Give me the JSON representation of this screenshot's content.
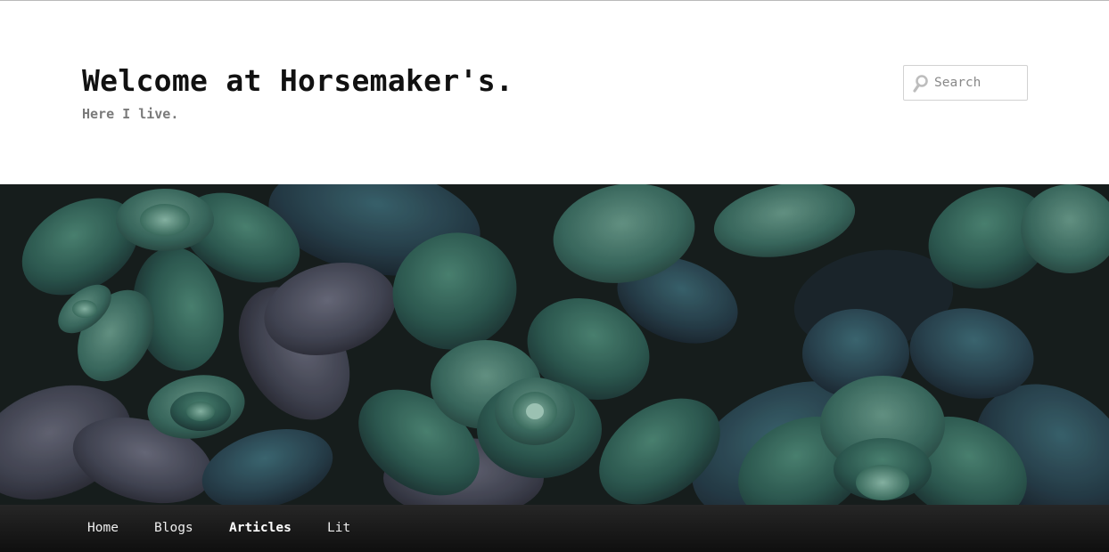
{
  "site": {
    "title": "Welcome at Horsemaker's.",
    "tagline": "Here I live."
  },
  "search": {
    "placeholder": "Search",
    "value": "",
    "icon": "search-icon"
  },
  "header_image": {
    "subject": "succulents-photo"
  },
  "nav": {
    "items": [
      {
        "label": "Home",
        "active": false
      },
      {
        "label": "Blogs",
        "active": false
      },
      {
        "label": "Articles",
        "active": true
      },
      {
        "label": "Lit",
        "active": false
      }
    ]
  },
  "colors": {
    "title": "#111111",
    "tagline": "#7a7a7a",
    "nav_background": "#1a1a1a",
    "nav_text": "#eeeeee"
  }
}
